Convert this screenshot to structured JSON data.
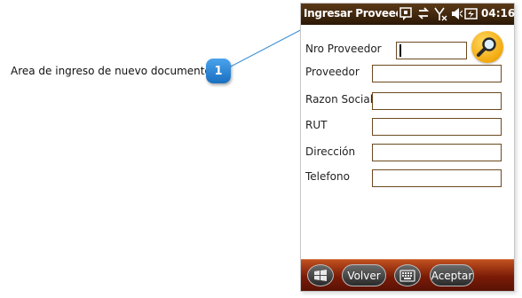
{
  "annotation": {
    "text": "Area de ingreso de nuevo documento",
    "badge": "1"
  },
  "device": {
    "title": "Ingresar Proveedor",
    "time": "04:16",
    "status_icons": [
      "notification-icon",
      "sync-icon",
      "no-signal-icon",
      "volume-mute-icon",
      "battery-icon"
    ]
  },
  "form": {
    "fields": [
      {
        "label": "Nro Proveedor",
        "value": ""
      },
      {
        "label": "Proveedor",
        "value": ""
      },
      {
        "label": "Razon Social",
        "value": ""
      },
      {
        "label": "RUT",
        "value": ""
      },
      {
        "label": "Dirección",
        "value": ""
      },
      {
        "label": "Telefono",
        "value": ""
      }
    ],
    "search_icon": "magnifier-icon"
  },
  "softkeys": {
    "start_icon": "windows-start-icon",
    "back_label": "Volver",
    "keyboard_icon": "keyboard-icon",
    "accept_label": "Aceptar"
  },
  "colors": {
    "titlebar": "#3a2410",
    "field_border": "#6b4a1f",
    "badge": "#2a86d8",
    "bottombar": "#8a2a0c"
  }
}
